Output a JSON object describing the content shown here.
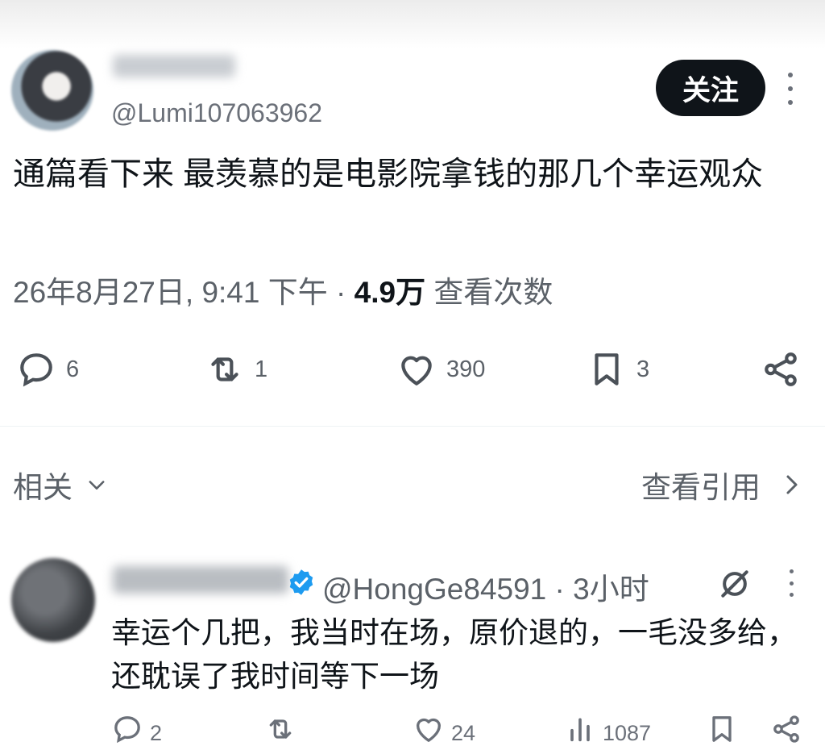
{
  "post": {
    "author_handle": "@Lumi107063962",
    "follow_label": "关注",
    "text": "通篇看下来 最羡慕的是电影院拿钱的那几个幸运观众",
    "timestamp": "26年8月27日, 9:41 下午",
    "separator": "·",
    "views_count": "4.9万",
    "views_label": "查看次数",
    "actions": {
      "reply_count": "6",
      "repost_count": "1",
      "like_count": "390",
      "bookmark_count": "3"
    }
  },
  "tabs": {
    "related_label": "相关",
    "quotes_label": "查看引用"
  },
  "reply": {
    "handle_and_time": "@HongGe84591 · 3小时",
    "text": "幸运个几把，我当时在场，原价退的，一毛没多给，还耽误了我时间等下一场",
    "actions": {
      "reply_count": "2",
      "like_count": "24",
      "views_count": "1087"
    }
  },
  "colors": {
    "text_primary": "#0f1419",
    "text_secondary": "#5b6168",
    "follow_bg": "#0f1419",
    "verified_blue": "#1d9bf0"
  }
}
